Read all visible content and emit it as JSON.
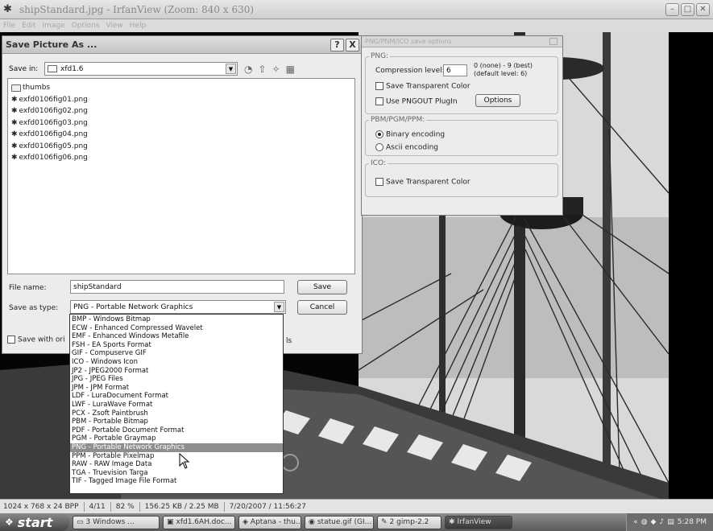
{
  "app": {
    "title": "shipStandard.jpg - IrfanView (Zoom: 840 x 630)",
    "menu": [
      "File",
      "Edit",
      "Image",
      "Options",
      "View",
      "Help"
    ]
  },
  "dialog": {
    "title": "Save Picture As ...",
    "help_label": "?",
    "close_label": "X",
    "save_in_label": "Save in:",
    "save_in_value": "xfd1.6",
    "files": [
      {
        "name": "thumbs",
        "type": "folder"
      },
      {
        "name": "exfd0106fig01.png",
        "type": "file"
      },
      {
        "name": "exfd0106fig02.png",
        "type": "file"
      },
      {
        "name": "exfd0106fig03.png",
        "type": "file"
      },
      {
        "name": "exfd0106fig04.png",
        "type": "file"
      },
      {
        "name": "exfd0106fig05.png",
        "type": "file"
      },
      {
        "name": "exfd0106fig06.png",
        "type": "file"
      }
    ],
    "file_name_label": "File name:",
    "file_name_value": "shipStandard",
    "save_type_label": "Save as type:",
    "save_type_value": "PNG - Portable Network Graphics",
    "save_button": "Save",
    "cancel_button": "Cancel",
    "save_original_label": "Save with ori",
    "save_original_tail": "ls"
  },
  "type_options": [
    "BMP - Windows Bitmap",
    "ECW - Enhanced Compressed Wavelet",
    "EMF - Enhanced Windows Metafile",
    "FSH - EA Sports Format",
    "GIF - Compuserve GIF",
    "ICO - Windows Icon",
    "JP2 - JPEG2000 Format",
    "JPG - JPEG Files",
    "JPM - JPM Format",
    "LDF - LuraDocument Format",
    "LWF - LuraWave Format",
    "PCX - Zsoft Paintbrush",
    "PBM - Portable Bitmap",
    "PDF - Portable Document Format",
    "PGM - Portable Graymap",
    "PNG - Portable Network Graphics",
    "PPM - Portable Pixelmap",
    "RAW - RAW Image Data",
    "TGA - Truevision Targa",
    "TIF - Tagged Image File Format"
  ],
  "selected_option_index": 15,
  "png_options": {
    "title": "PNG/PNM/ICO save options",
    "png_group": "PNG:",
    "compression_label": "Compression level:",
    "compression_value": "6",
    "compression_hint_1": "0 (none) - 9 (best)",
    "compression_hint_2": "(default level: 6)",
    "save_transparent": "Save Transparent Color",
    "use_pngout": "Use PNGOUT PlugIn",
    "options_button": "Options",
    "pbm_group": "PBM/PGM/PPM:",
    "binary_encoding": "Binary encoding",
    "ascii_encoding": "Ascii encoding",
    "ico_group": "ICO:",
    "ico_save_transparent": "Save Transparent Color"
  },
  "statusbar": {
    "dimensions": "1024 x 768 x 24 BPP",
    "index": "4/11",
    "zoom": "82 %",
    "size": "156.25 KB / 2.25 MB",
    "datetime": "7/20/2007 / 11:56:27"
  },
  "taskbar": {
    "start": "start",
    "items": [
      "3 Windows ...",
      "xfd1.6AH.doc...",
      "Aptana - thu...",
      "statue.gif (GI...",
      "2 gimp-2.2",
      "IrfanView"
    ],
    "clock": "5:28 PM"
  }
}
